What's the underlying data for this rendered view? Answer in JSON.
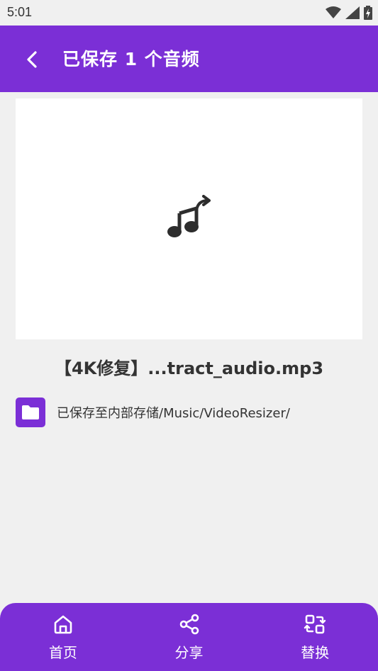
{
  "status_bar": {
    "time": "5:01"
  },
  "app_bar": {
    "title": "已保存 1 个音频"
  },
  "preview": {
    "icon": "audio-extract-icon"
  },
  "file": {
    "name": "【4K修复】...tract_audio.mp3",
    "save_path": "已保存至内部存储/Music/VideoResizer/"
  },
  "bottom_nav": {
    "items": [
      {
        "label": "首页",
        "icon": "home-icon"
      },
      {
        "label": "分享",
        "icon": "share-icon"
      },
      {
        "label": "替换",
        "icon": "replace-icon"
      }
    ]
  },
  "colors": {
    "accent": "#7b2fd6",
    "background": "#f0f0f0"
  }
}
